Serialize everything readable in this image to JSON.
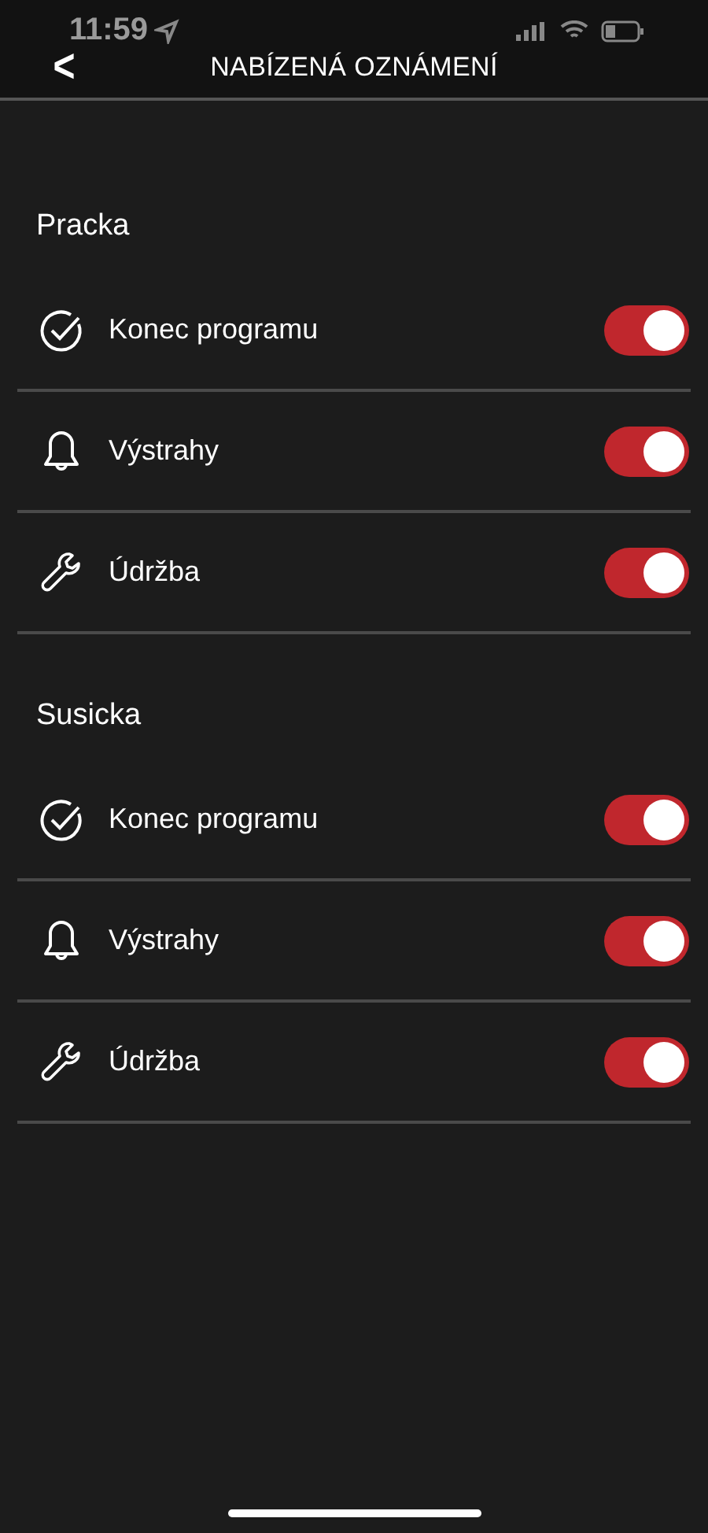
{
  "status_bar": {
    "time": "11:59"
  },
  "header": {
    "back": "<",
    "title": "NABÍZENÁ OZNÁMENÍ"
  },
  "sections": [
    {
      "title": "Pracka",
      "items": [
        {
          "kind": "check",
          "label": "Konec programu",
          "on": true
        },
        {
          "kind": "bell",
          "label": "Výstrahy",
          "on": true
        },
        {
          "kind": "wrench",
          "label": "Údržba",
          "on": true
        }
      ]
    },
    {
      "title": "Susicka",
      "items": [
        {
          "kind": "check",
          "label": "Konec programu",
          "on": true
        },
        {
          "kind": "bell",
          "label": "Výstrahy",
          "on": true
        },
        {
          "kind": "wrench",
          "label": "Údržba",
          "on": true
        }
      ]
    }
  ]
}
